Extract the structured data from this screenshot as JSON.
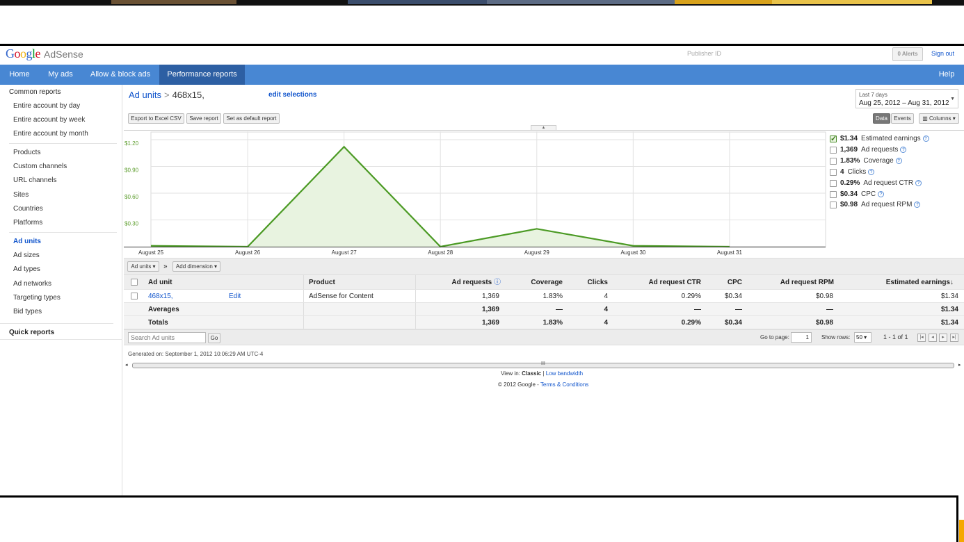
{
  "brand": {
    "logo_letters": [
      "G",
      "o",
      "o",
      "g",
      "l",
      "e"
    ],
    "product": "AdSense"
  },
  "header": {
    "publisher_id_label": "Publisher ID",
    "alerts_label": "0 Alerts",
    "signout_label": "Sign out"
  },
  "nav": {
    "tabs": [
      "Home",
      "My ads",
      "Allow & block ads",
      "Performance reports"
    ],
    "help": "Help",
    "active": "Performance reports"
  },
  "sidebar": {
    "common_reports": "Common reports",
    "group1": [
      "Entire account by day",
      "Entire account by week",
      "Entire account by month"
    ],
    "group2": [
      "Products",
      "Custom channels",
      "URL channels",
      "Sites",
      "Countries",
      "Platforms"
    ],
    "group3": [
      "Ad units",
      "Ad sizes",
      "Ad types",
      "Ad networks",
      "Targeting types",
      "Bid types"
    ],
    "quick_reports": "Quick reports"
  },
  "breadcrumb": {
    "root": "Ad units",
    "separator": ">",
    "current": "468x15,",
    "edit": "edit selections"
  },
  "date_range": {
    "label": "Last 7 days",
    "value": "Aug 25, 2012 – Aug 31, 2012"
  },
  "toolbar": {
    "export": "Export to Excel CSV",
    "save": "Save report",
    "default": "Set as default report",
    "data": "Data",
    "events": "Events",
    "columns": "Columns"
  },
  "colors": {
    "series": "#4b9a24",
    "fill": "#e8f3e0",
    "nav": "#4887d3",
    "nav_active": "#2d5fa3",
    "link": "#1155cc"
  },
  "chart_data": {
    "type": "area",
    "x": [
      "August 25",
      "August 26",
      "August 27",
      "August 28",
      "August 29",
      "August 30",
      "August 31"
    ],
    "series": [
      {
        "name": "Estimated earnings",
        "values": [
          0.01,
          0.0,
          1.12,
          0.0,
          0.2,
          0.01,
          0.0
        ]
      }
    ],
    "ylim": [
      0,
      1.2
    ],
    "yticks": [
      "$1.20",
      "$0.90",
      "$0.60",
      "$0.30"
    ],
    "ytick_values": [
      1.2,
      0.9,
      0.6,
      0.3
    ],
    "grid": true
  },
  "legend": [
    {
      "value": "$1.34",
      "name": "Estimated earnings",
      "checked": true
    },
    {
      "value": "1,369",
      "name": "Ad requests",
      "checked": false
    },
    {
      "value": "1.83%",
      "name": "Coverage",
      "checked": false
    },
    {
      "value": "4",
      "name": "Clicks",
      "checked": false
    },
    {
      "value": "0.29%",
      "name": "Ad request CTR",
      "checked": false
    },
    {
      "value": "$0.34",
      "name": "CPC",
      "checked": false
    },
    {
      "value": "$0.98",
      "name": "Ad request RPM",
      "checked": false
    }
  ],
  "table_toolbar": {
    "dimension": "Ad units",
    "arrow": "»",
    "add_dimension": "Add dimension"
  },
  "table": {
    "headers": [
      "Ad unit",
      "Product",
      "Ad requests",
      "Coverage",
      "Clicks",
      "Ad request CTR",
      "CPC",
      "Ad request RPM",
      "Estimated earnings"
    ],
    "sort_indicator": "↓",
    "rows": [
      {
        "ad_unit": "468x15,",
        "edit": "Edit",
        "product": "AdSense for Content",
        "ad_requests": "1,369",
        "coverage": "1.83%",
        "clicks": "4",
        "ctr": "0.29%",
        "cpc": "$0.34",
        "rpm": "$0.98",
        "earnings": "$1.34"
      }
    ],
    "averages": {
      "label": "Averages",
      "ad_requests": "1,369",
      "coverage": "—",
      "clicks": "4",
      "ctr": "—",
      "cpc": "—",
      "rpm": "—",
      "earnings": "$1.34"
    },
    "totals": {
      "label": "Totals",
      "ad_requests": "1,369",
      "coverage": "1.83%",
      "clicks": "4",
      "ctr": "0.29%",
      "cpc": "$0.34",
      "rpm": "$0.98",
      "earnings": "$1.34"
    }
  },
  "pager": {
    "search_placeholder": "Search Ad units",
    "go": "Go",
    "goto_label": "Go to page:",
    "page": "1",
    "rows_label": "Show rows:",
    "rows": "50",
    "range": "1 - 1 of 1"
  },
  "footer": {
    "generated": "Generated on: September 1, 2012 10:06:29 AM UTC-4",
    "view_in": "View in:",
    "classic": "Classic",
    "bar": "|",
    "low_bandwidth": "Low bandwidth",
    "copyright": "© 2012 Google -",
    "terms": "Terms & Conditions"
  }
}
